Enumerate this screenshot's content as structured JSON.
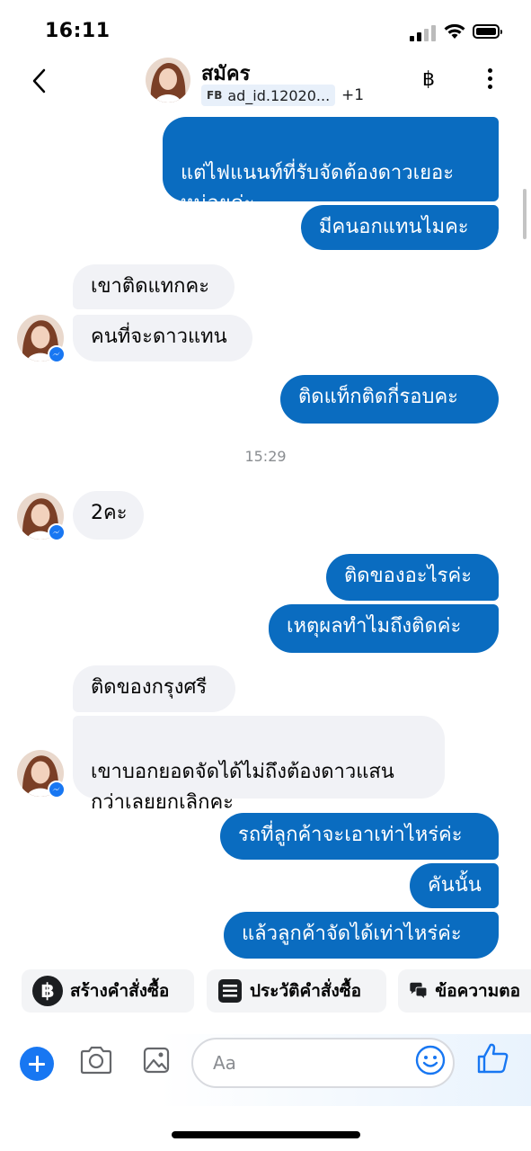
{
  "status_bar": {
    "time": "16:11"
  },
  "header": {
    "contact_name": "สมัคร",
    "tag_prefix": "FB",
    "tag_text": "ad_id.12020...",
    "extra_count": "+1",
    "currency_icon": "฿"
  },
  "messages": [
    {
      "dir": "out",
      "text": "แต่ไฟแนนท์ที่รับจัดต้องดาวเยอะ\nหน่อยค่ะ"
    },
    {
      "dir": "out",
      "text": "มีคนอกแทนไมคะ"
    },
    {
      "dir": "in",
      "text": "เขาติดแทกคะ"
    },
    {
      "dir": "in",
      "text": "คนที่จะดาวแทน"
    },
    {
      "dir": "out",
      "text": "ติดแท็กติดกี่รอบคะ"
    },
    {
      "dir": "time",
      "text": "15:29"
    },
    {
      "dir": "in",
      "text": "2คะ"
    },
    {
      "dir": "out",
      "text": "ติดของอะไรค่ะ"
    },
    {
      "dir": "out",
      "text": "เหตุผลทำไมถึงติดค่ะ"
    },
    {
      "dir": "in",
      "text": "ติดของกรุงศรี"
    },
    {
      "dir": "in",
      "text": "เขาบอกยอดจัดได้ไม่ถึงต้องดาวแสน\nกว่าเลยยกเลิกคะ"
    },
    {
      "dir": "out",
      "text": "รถที่ลูกค้าจะเอาเท่าไหร่ค่ะ"
    },
    {
      "dir": "out",
      "text": "คันนั้น"
    },
    {
      "dir": "out",
      "text": "แล้วลูกค้าจัดได้เท่าไหร่ค่ะ"
    }
  ],
  "quick_actions": [
    {
      "label": "สร้างคำสั่งซื้อ",
      "icon": "baht-circle-icon"
    },
    {
      "label": "ประวัติคำสั่งซื้อ",
      "icon": "list-document-icon"
    },
    {
      "label": "ข้อความตอ",
      "icon": "chat-bubbles-icon"
    }
  ],
  "composer": {
    "placeholder": "Aa"
  },
  "colors": {
    "outgoing_bubble": "#0a6cc0",
    "incoming_bubble": "#f1f2f6",
    "accent": "#1877f2"
  }
}
